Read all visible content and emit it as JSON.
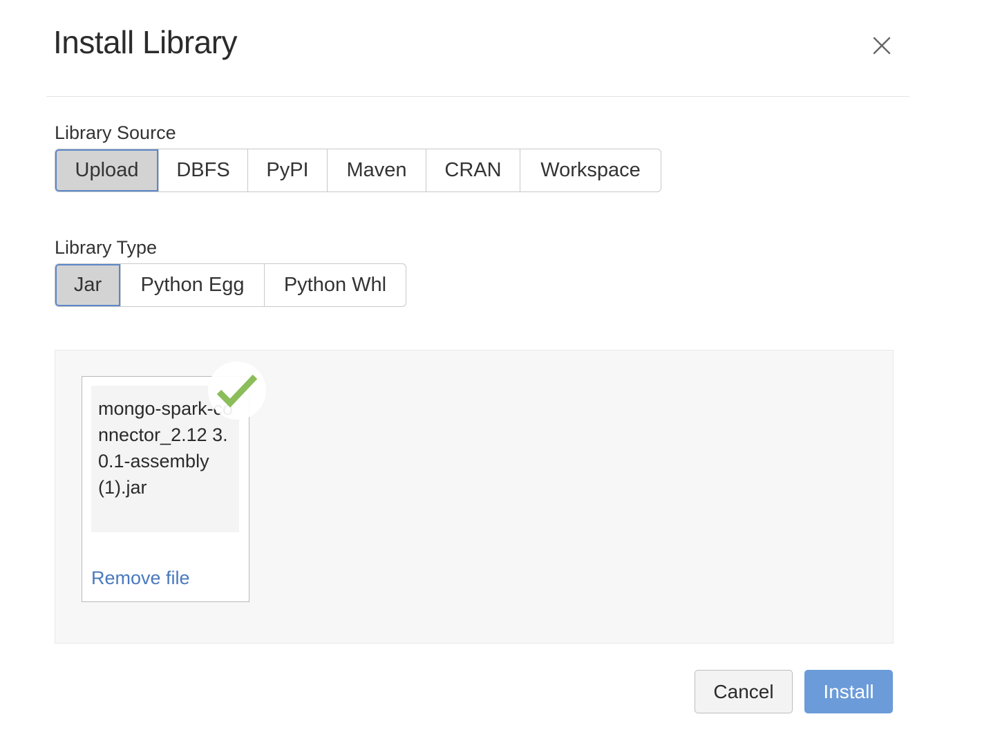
{
  "dialog": {
    "title": "Install Library"
  },
  "library_source": {
    "label": "Library Source",
    "options": [
      "Upload",
      "DBFS",
      "PyPI",
      "Maven",
      "CRAN",
      "Workspace"
    ],
    "selected": "Upload"
  },
  "library_type": {
    "label": "Library Type",
    "options": [
      "Jar",
      "Python Egg",
      "Python Whl"
    ],
    "selected": "Jar"
  },
  "upload": {
    "file_name": "mongo-spark-connector_2.12 3.0.1-assembly (1).jar",
    "remove_label": "Remove file",
    "status_icon": "check-icon",
    "status_color": "#8bbd5a"
  },
  "footer": {
    "cancel_label": "Cancel",
    "install_label": "Install"
  },
  "colors": {
    "accent": "#6b9bd8",
    "link": "#4a79bd",
    "active_segment_bg": "#d3d3d3",
    "active_segment_border": "#5b87c8"
  }
}
